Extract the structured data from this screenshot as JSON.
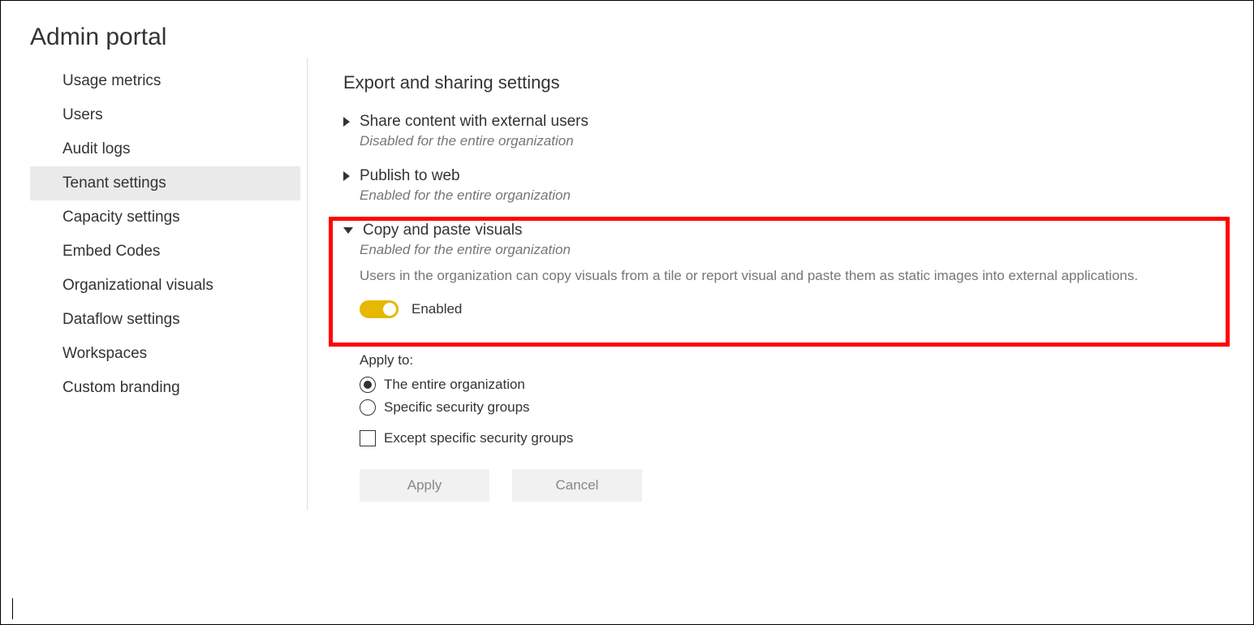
{
  "header": {
    "title": "Admin portal"
  },
  "sidebar": {
    "items": [
      {
        "label": "Usage metrics",
        "selected": false
      },
      {
        "label": "Users",
        "selected": false
      },
      {
        "label": "Audit logs",
        "selected": false
      },
      {
        "label": "Tenant settings",
        "selected": true
      },
      {
        "label": "Capacity settings",
        "selected": false
      },
      {
        "label": "Embed Codes",
        "selected": false
      },
      {
        "label": "Organizational visuals",
        "selected": false
      },
      {
        "label": "Dataflow settings",
        "selected": false
      },
      {
        "label": "Workspaces",
        "selected": false
      },
      {
        "label": "Custom branding",
        "selected": false
      }
    ]
  },
  "main": {
    "section_title": "Export and sharing settings",
    "settings": [
      {
        "title": "Share content with external users",
        "status": "Disabled for the entire organization",
        "expanded": false
      },
      {
        "title": "Publish to web",
        "status": "Enabled for the entire organization",
        "expanded": false
      },
      {
        "title": "Copy and paste visuals",
        "status": "Enabled for the entire organization",
        "expanded": true,
        "description": "Users in the organization can copy visuals from a tile or report visual and paste them as static images into external applications.",
        "toggle": {
          "enabled": true,
          "label": "Enabled"
        }
      }
    ],
    "apply": {
      "label": "Apply to:",
      "options": [
        {
          "label": "The entire organization",
          "selected": true
        },
        {
          "label": "Specific security groups",
          "selected": false
        }
      ],
      "except": {
        "label": "Except specific security groups",
        "checked": false
      }
    },
    "buttons": {
      "apply": "Apply",
      "cancel": "Cancel"
    }
  }
}
